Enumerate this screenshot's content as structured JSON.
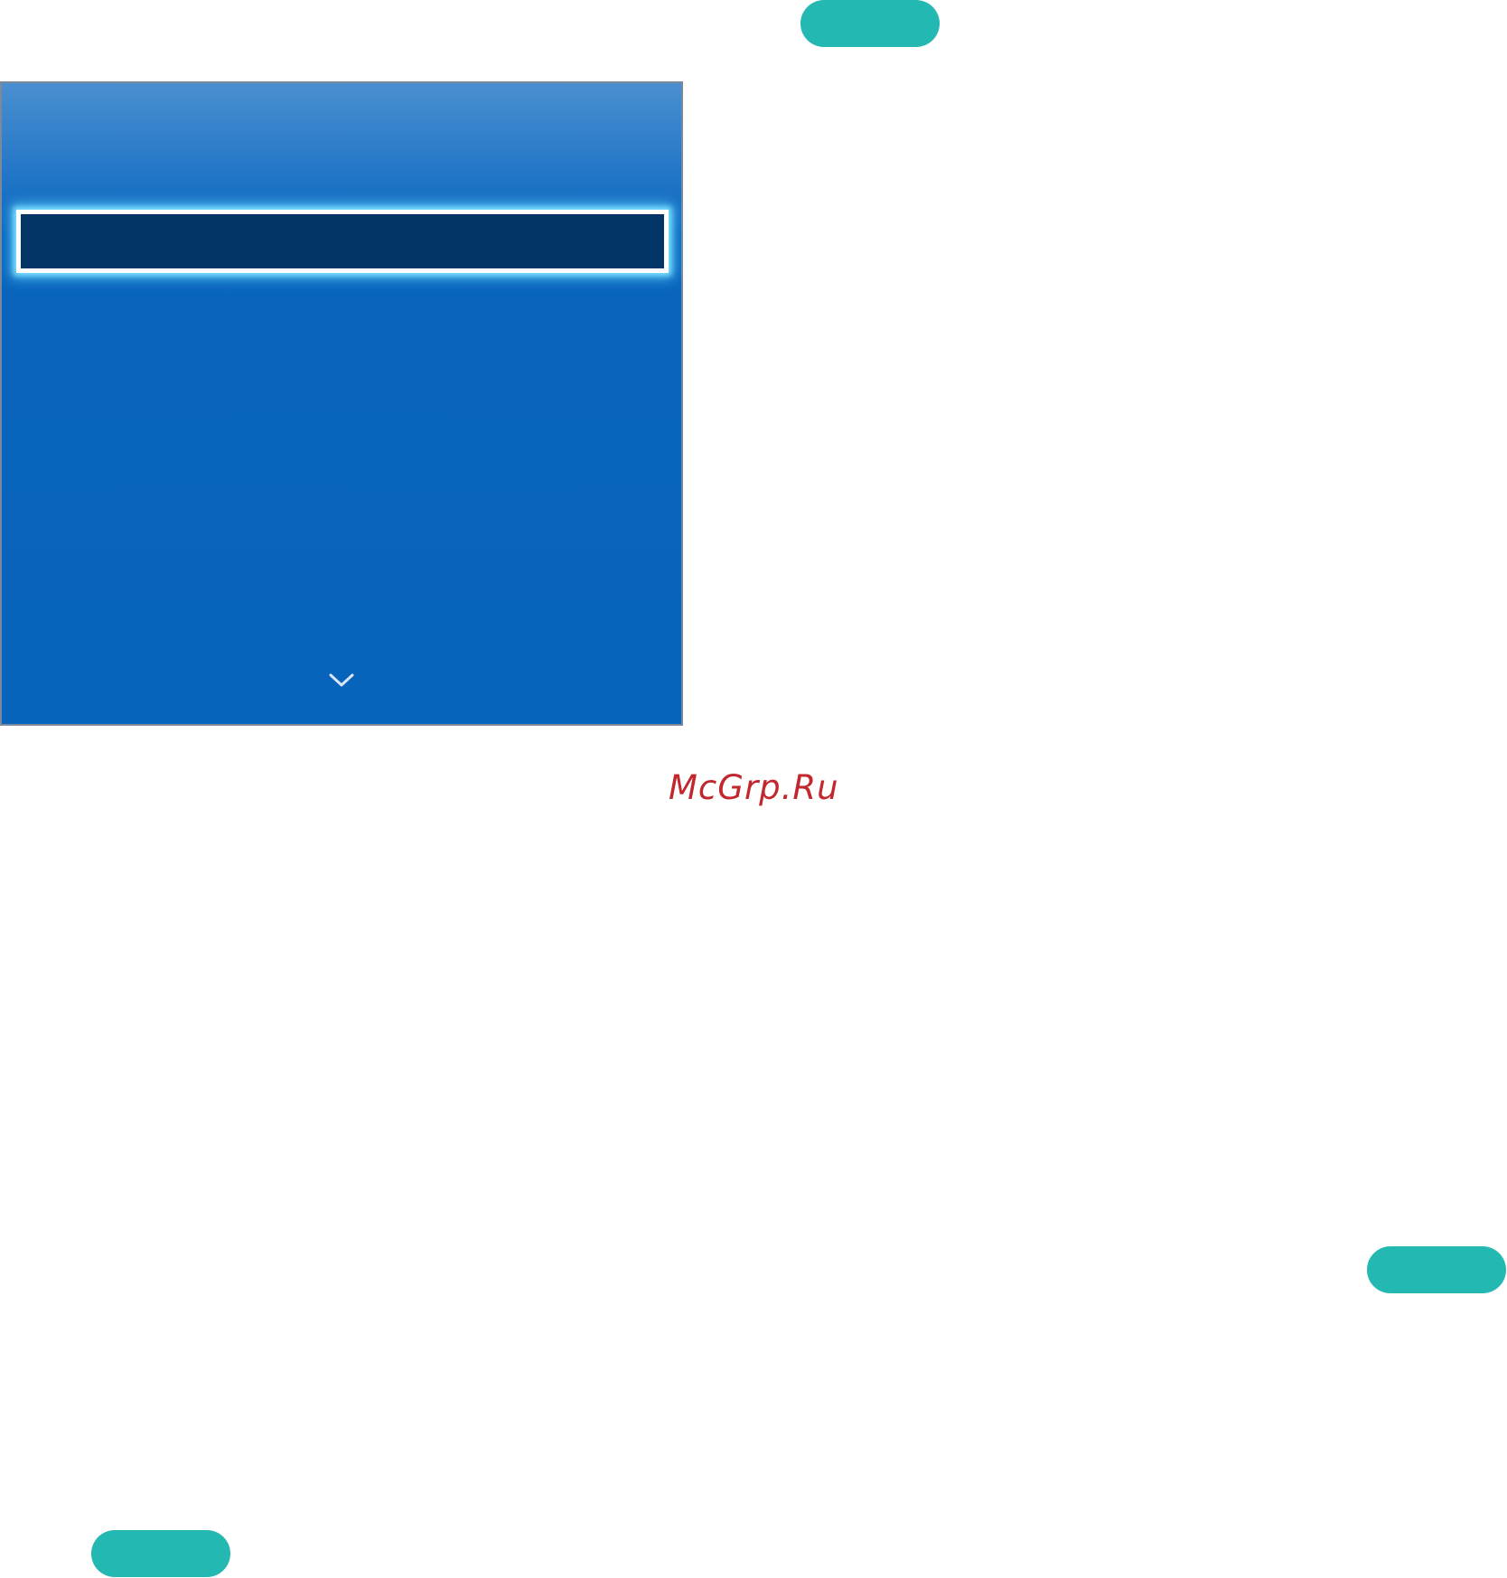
{
  "page": {
    "background_color": "#ffffff"
  },
  "pills": {
    "color": "#24b8b2",
    "items": [
      "top",
      "right",
      "bottom"
    ]
  },
  "tv_menu": {
    "background_color": "#0863ba",
    "header_gradient_top": "#4a8fd0",
    "selected_item": {
      "label": "",
      "background_color": "#033566",
      "focus_border_color": "#ffffff",
      "focus_glow_color": "#5ed0ff"
    },
    "scroll_indicator": "chevron-down-icon"
  },
  "watermark": {
    "text": "McGrp.Ru",
    "color": "#c1272d"
  }
}
